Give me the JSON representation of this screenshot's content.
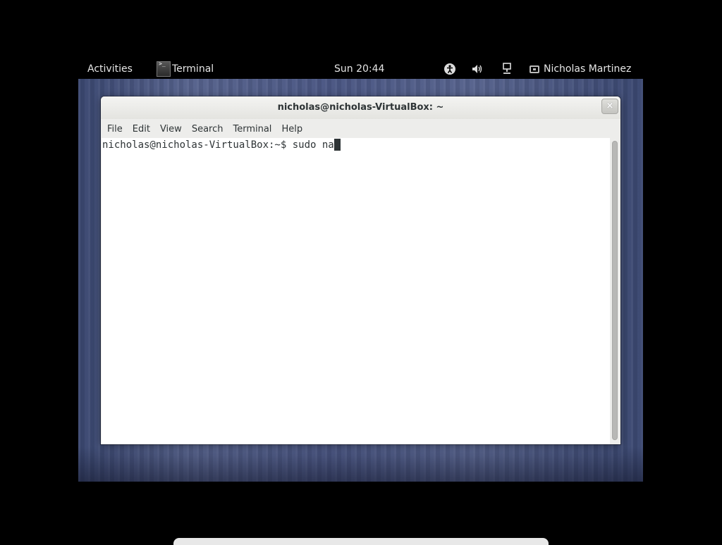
{
  "topbar": {
    "activities_label": "Activities",
    "app_name": "Terminal",
    "clock": "Sun 20:44",
    "user_name": "Nicholas Martinez",
    "icons": [
      "accessibility-icon",
      "volume-icon",
      "network-icon",
      "user-status-icon",
      "terminal-app-icon"
    ]
  },
  "window": {
    "title": "nicholas@nicholas-VirtualBox: ~",
    "close_label": "×",
    "menu": [
      "File",
      "Edit",
      "View",
      "Search",
      "Terminal",
      "Help"
    ]
  },
  "terminal": {
    "prompt": "nicholas@nicholas-VirtualBox:~$ ",
    "input": "sudo na"
  },
  "colors": {
    "topbar_bg": "#000000",
    "topbar_text": "#e6e6e6",
    "desktop_accent": "#4a5683",
    "terminal_text": "#2e3436"
  }
}
